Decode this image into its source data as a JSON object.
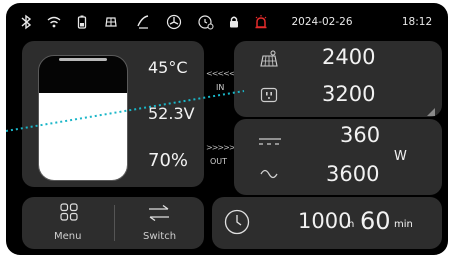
{
  "status_bar": {
    "icons": [
      "bluetooth-icon",
      "wifi-icon",
      "battery-icon",
      "solar-icon",
      "fan-icon",
      "cooling-icon",
      "timer-icon",
      "lock-icon",
      "alarm-icon"
    ],
    "date": "2024-02-26",
    "time": "18:12",
    "alarm_color": "#e32b2b"
  },
  "battery": {
    "temperature": "45°C",
    "voltage": "52.3V",
    "level_text": "70%",
    "level": 0.7
  },
  "flow": {
    "in_label": "IN",
    "out_label": "OUT",
    "in_arrows": "<<<<<",
    "out_arrows": ">>>>>"
  },
  "input": {
    "solar_value": "2400",
    "ac_value": "3200"
  },
  "output": {
    "dc_value": "360",
    "ac_value": "3600",
    "unit": "W"
  },
  "nav": {
    "menu_label": "Menu",
    "switch_label": "Switch"
  },
  "runtime": {
    "hours": "1000",
    "hours_unit": "h",
    "minutes": "60",
    "minutes_unit": "min"
  },
  "colors": {
    "panel": "#2d2d2d",
    "background": "#000000",
    "overlay_line": "#1ab6c8"
  }
}
